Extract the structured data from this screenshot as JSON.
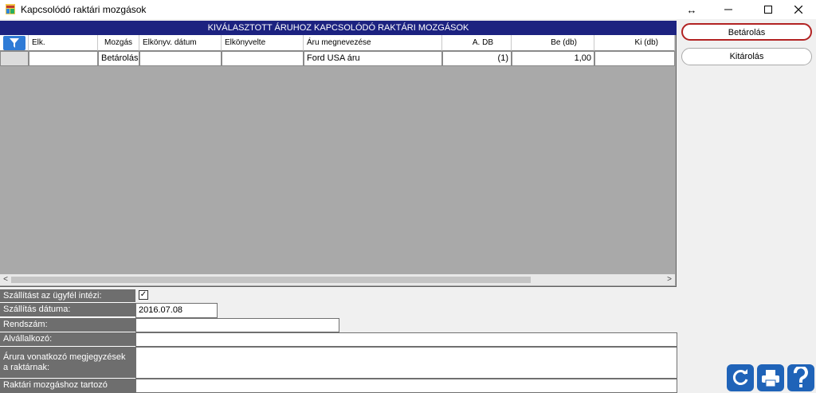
{
  "window": {
    "title": "Kapcsolódó raktári mozgások",
    "resize_glyph": "↔",
    "maximize_glyph": "☐",
    "close_glyph": "✕"
  },
  "grid": {
    "header": "KIVÁLASZTOTT ÁRUHOZ KAPCSOLÓDÓ RAKTÁRI MOZGÁSOK",
    "columns": [
      "Elk.",
      "Mozgás",
      "Elkönyv. dátum",
      "Elkönyvelte",
      "Áru megnevezése",
      "A. DB",
      "Be (db)",
      "Ki (db)"
    ],
    "rows": [
      {
        "elk": "",
        "mozgas": "Betárolás",
        "datum": "",
        "elkonyvelte": "",
        "aru": "Ford USA áru",
        "adb": "(1)",
        "be": "1,00",
        "ki": ""
      }
    ],
    "scroll_left": "<",
    "scroll_right": ">"
  },
  "form": {
    "szallitas_ugyfel_label": "Szállítást az ügyfél intézi:",
    "szallitas_ugyfel_checked": true,
    "checkmark": "✓",
    "szallitas_datum_label": "Szállítás dátuma:",
    "szallitas_datum_value": "2016.07.08",
    "rendszam_label": "Rendszám:",
    "rendszam_value": "",
    "alvallalkozo_label": "Alvállalkozó:",
    "alvallalkozo_value": "",
    "megjegyzes_label": "Árura vonatkozó megjegyzések a raktárnak:",
    "megjegyzes_value": "",
    "tartozo_label": "Raktári mozgáshoz tartozó"
  },
  "sidebar": {
    "betarolas_label": "Betárolás",
    "kitarolas_label": "Kitárolás"
  },
  "icons": {
    "filter": "filter-icon",
    "refresh": "refresh-icon",
    "print": "printer-icon",
    "help": "help-icon"
  },
  "colors": {
    "header_bg": "#1c2280",
    "grid_bg": "#a9a9a9",
    "label_bg": "#6e6e6e",
    "selected_border": "#b22222",
    "icon_blue": "#1f63b8"
  }
}
